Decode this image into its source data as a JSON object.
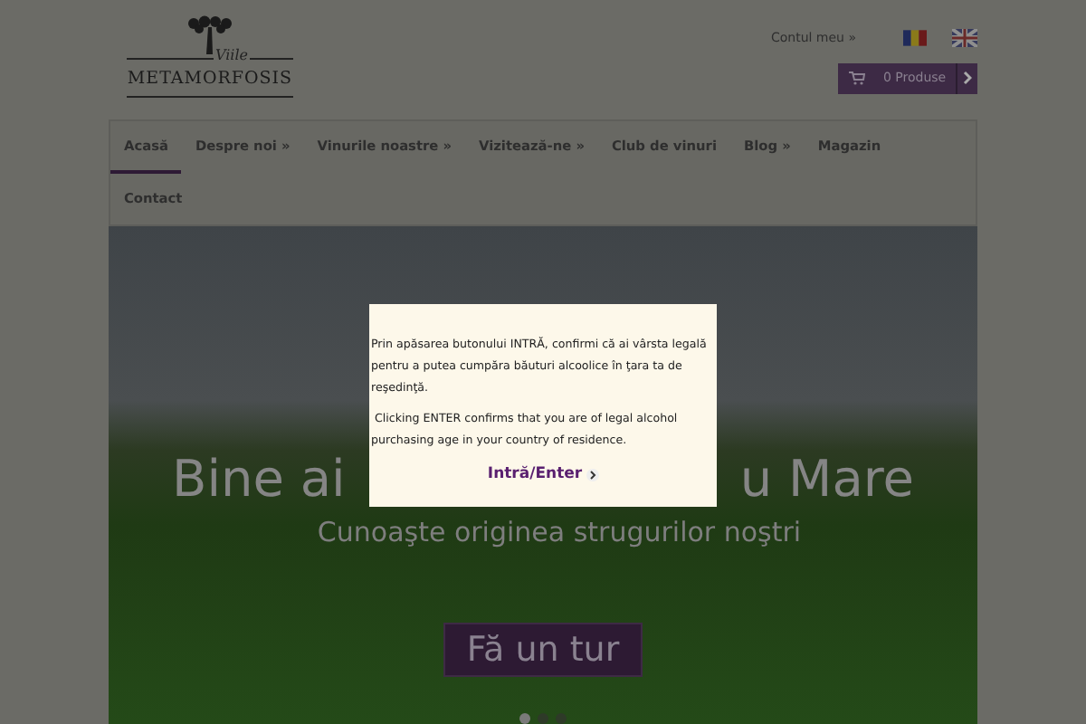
{
  "header": {
    "logo": {
      "script": "Viile",
      "name": "METAMORFOSIS"
    },
    "account_link": "Contul meu »",
    "languages": [
      {
        "kind": "ro",
        "selected": true
      },
      {
        "kind": "en",
        "selected": false
      }
    ],
    "cart": {
      "label": "0 Produse"
    }
  },
  "nav": [
    {
      "label": "Acasă",
      "selected": true
    },
    {
      "label": "Despre noi »",
      "selected": false
    },
    {
      "label": "Vinurile noastre »",
      "selected": false
    },
    {
      "label": "Vizitează-ne »",
      "selected": false
    },
    {
      "label": "Club de vinuri",
      "selected": false
    },
    {
      "label": "Blog »",
      "selected": false
    },
    {
      "label": "Magazin",
      "selected": false
    },
    {
      "label": "Contact",
      "selected": false
    }
  ],
  "hero": {
    "title_left": "Bine ai",
    "title_right": "u Mare",
    "subtitle": "Cunoaşte originea strugurilor noştri",
    "button": "Fă un tur",
    "dots": [
      {
        "selected": true
      },
      {
        "selected": false
      },
      {
        "selected": false
      }
    ]
  },
  "modal": {
    "paragraphs": [
      "Prin apăsarea butonului INTRĂ, confirmi că ai vârsta legală pentru a putea cumpăra băuturi alcoolice în ţara ta de reşedinţă.",
      " Clicking ENTER confirms that you are of legal alcohol purchasing age in your country of residence."
    ],
    "button": "Intră/Enter"
  }
}
